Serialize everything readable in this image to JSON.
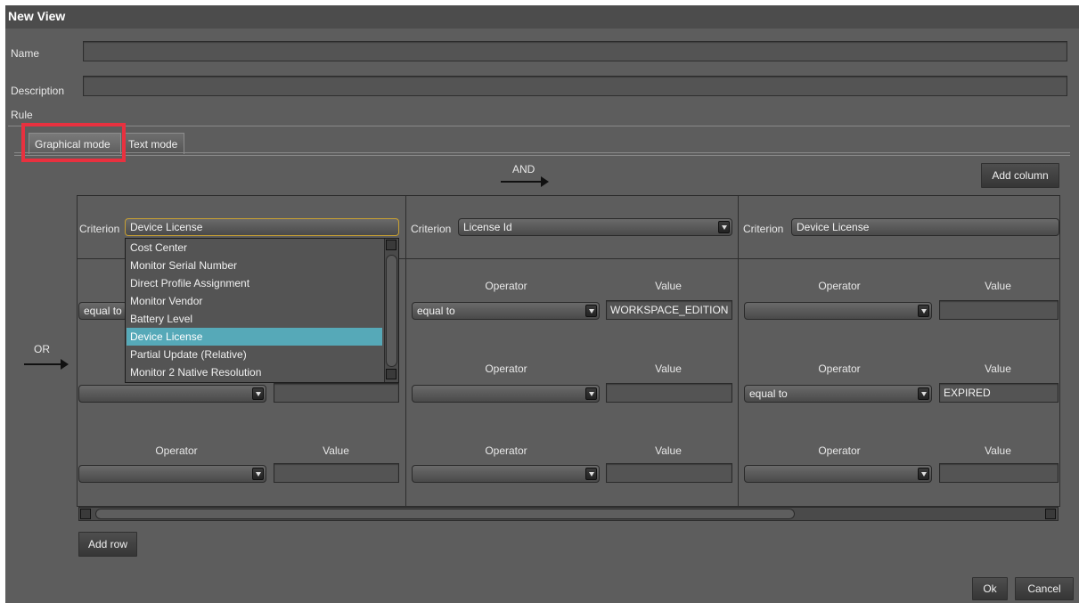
{
  "window": {
    "title": "New View"
  },
  "form": {
    "name_label": "Name",
    "name_value": "",
    "description_label": "Description",
    "description_value": "",
    "rule_label": "Rule"
  },
  "tabs": [
    {
      "label": "Graphical mode",
      "active": true
    },
    {
      "label": "Text mode",
      "active": false
    }
  ],
  "rule_editor": {
    "and_label": "AND",
    "or_label": "OR",
    "add_column_label": "Add column",
    "add_row_label": "Add row",
    "criterion_label": "Criterion",
    "operator_header": "Operator",
    "value_header": "Value",
    "columns": [
      {
        "criterion": "Device License",
        "rows": [
          {
            "operator": "equal to",
            "value": ""
          },
          {
            "operator": "",
            "value": ""
          },
          {
            "operator": "",
            "value": ""
          }
        ]
      },
      {
        "criterion": "License Id",
        "rows": [
          {
            "operator": "equal to",
            "value": "WORKSPACE_EDITION"
          },
          {
            "operator": "",
            "value": ""
          },
          {
            "operator": "",
            "value": ""
          }
        ]
      },
      {
        "criterion": "Device License",
        "rows": [
          {
            "operator": "",
            "value": ""
          },
          {
            "operator": "equal to",
            "value": "EXPIRED"
          },
          {
            "operator": "",
            "value": ""
          }
        ]
      }
    ],
    "criterion_dropdown": {
      "open": true,
      "selected": "Device License",
      "options": [
        "Cost Center",
        "Monitor Serial Number",
        "Direct Profile Assignment",
        "Monitor Vendor",
        "Battery Level",
        "Device License",
        "Partial Update (Relative)",
        "Monitor 2 Native Resolution"
      ]
    }
  },
  "footer": {
    "ok_label": "Ok",
    "cancel_label": "Cancel"
  },
  "colors": {
    "highlight": "#e8313f",
    "selection": "#56a9b8",
    "focus": "#c8a032"
  }
}
